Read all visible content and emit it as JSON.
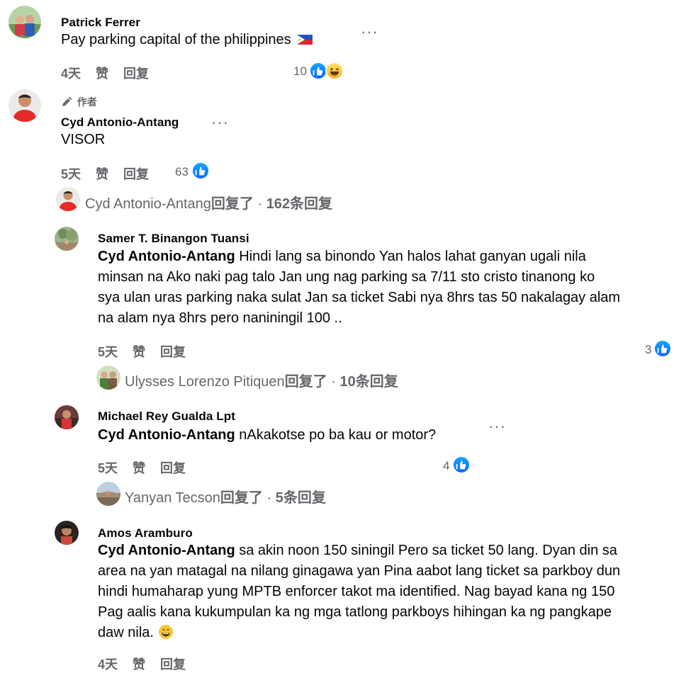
{
  "comments": [
    {
      "name": "Patrick Ferrer",
      "text": "Pay parking capital of the philippines",
      "time": "4天",
      "like_label": "赞",
      "reply_label": "回复",
      "reaction_count": "10"
    },
    {
      "badge": "作者",
      "name": "Cyd Antonio-Antang",
      "text": "VISOR",
      "time": "5天",
      "like_label": "赞",
      "reply_label": "回复",
      "reaction_count": "63",
      "reply_summary": {
        "who": "Cyd Antonio-Antang",
        "action": "回复了",
        "sep": " · ",
        "count": "162条回复"
      }
    }
  ],
  "replies": [
    {
      "name": "Samer T. Binangon Tuansi",
      "mention": "Cyd Antonio-Antang",
      "lines": [
        " Hindi lang sa binondo Yan halos lahat ganyan ugali nila",
        "minsan na Ako naki pag talo Jan ung nag parking sa 7/11 sto cristo tinanong ko",
        "sya ulan uras parking naka sulat Jan sa ticket Sabi nya 8hrs tas 50 nakalagay alam",
        "na alam nya 8hrs pero naniningil 100 .."
      ],
      "time": "5天",
      "like_label": "赞",
      "reply_label": "回复",
      "reaction_count": "3",
      "reply_summary": {
        "who": "Ulysses Lorenzo Pitiquen",
        "action": "回复了",
        "sep": " · ",
        "count": "10条回复"
      }
    },
    {
      "name": "Michael Rey Gualda Lpt",
      "mention": "Cyd Antonio-Antang",
      "lines": [
        " nAkakotse po ba kau or motor?"
      ],
      "time": "5天",
      "like_label": "赞",
      "reply_label": "回复",
      "reaction_count": "4",
      "reply_summary": {
        "who": "Yanyan Tecson",
        "action": "回复了",
        "sep": " · ",
        "count": "5条回复"
      }
    },
    {
      "name": "Amos Aramburo",
      "mention": "Cyd Antonio-Antang",
      "lines": [
        " sa akin noon 150 siningil Pero sa ticket 50 lang. Dyan din sa",
        "area na yan matagal na nilang ginagawa yan Pina aabot lang ticket sa parkboy dun",
        "hindi humaharap yung MPTB enforcer takot ma identified. Nag bayad kana ng 150",
        "Pag aalis kana kukumpulan ka ng mga tatlong parkboys hihingan ka ng pangkape",
        "daw nila."
      ],
      "time": "4天",
      "like_label": "赞",
      "reply_label": "回复"
    }
  ],
  "icons": {
    "like": "like-reaction-icon",
    "haha": "haha-reaction-icon",
    "more": "more-options-icon",
    "author": "pencil-icon",
    "flag": "philippines-flag-emoji",
    "smile": "grinning-emoji"
  },
  "colors": {
    "text": "#050505",
    "secondary": "#65676b",
    "like_blue": "#0866ff"
  }
}
